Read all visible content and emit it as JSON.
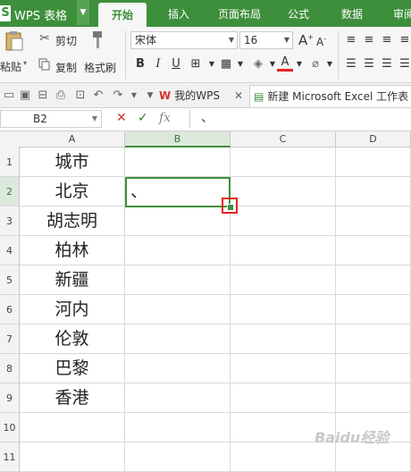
{
  "app": {
    "logo": "S",
    "title": "WPS 表格"
  },
  "tabs": [
    "开始",
    "插入",
    "页面布局",
    "公式",
    "数据",
    "审阅"
  ],
  "ribbon": {
    "paste": "粘贴",
    "cut": "剪切",
    "copy": "复制",
    "format_painter": "格式刷",
    "font_name": "宋体",
    "font_size": "16",
    "bold": "B",
    "italic": "I",
    "underline": "U",
    "grow_font": "A",
    "shrink_font": "A",
    "font_color_label": "A"
  },
  "doc_tabs": [
    {
      "label": "我的WPS",
      "icon": "wps-logo-icon"
    },
    {
      "label": "新建 Microsoft Excel 工作表",
      "icon": "excel-file-icon"
    }
  ],
  "formula_bar": {
    "cell_ref": "B2",
    "fx": "fx",
    "content": "、"
  },
  "columns": [
    "A",
    "B",
    "C",
    "D"
  ],
  "selected_column": "B",
  "rows": [
    {
      "num": "1",
      "a": "城市",
      "b": ""
    },
    {
      "num": "2",
      "a": "北京",
      "b": "、"
    },
    {
      "num": "3",
      "a": "胡志明",
      "b": ""
    },
    {
      "num": "4",
      "a": "柏林",
      "b": ""
    },
    {
      "num": "5",
      "a": "新疆",
      "b": ""
    },
    {
      "num": "6",
      "a": "河内",
      "b": ""
    },
    {
      "num": "7",
      "a": "伦敦",
      "b": ""
    },
    {
      "num": "8",
      "a": "巴黎",
      "b": ""
    },
    {
      "num": "9",
      "a": "香港",
      "b": ""
    },
    {
      "num": "10",
      "a": "",
      "b": ""
    },
    {
      "num": "11",
      "a": "",
      "b": ""
    }
  ],
  "watermark": "Baidu经验",
  "colors": {
    "accent": "#3d8f3b",
    "highlight": "#e52222"
  }
}
